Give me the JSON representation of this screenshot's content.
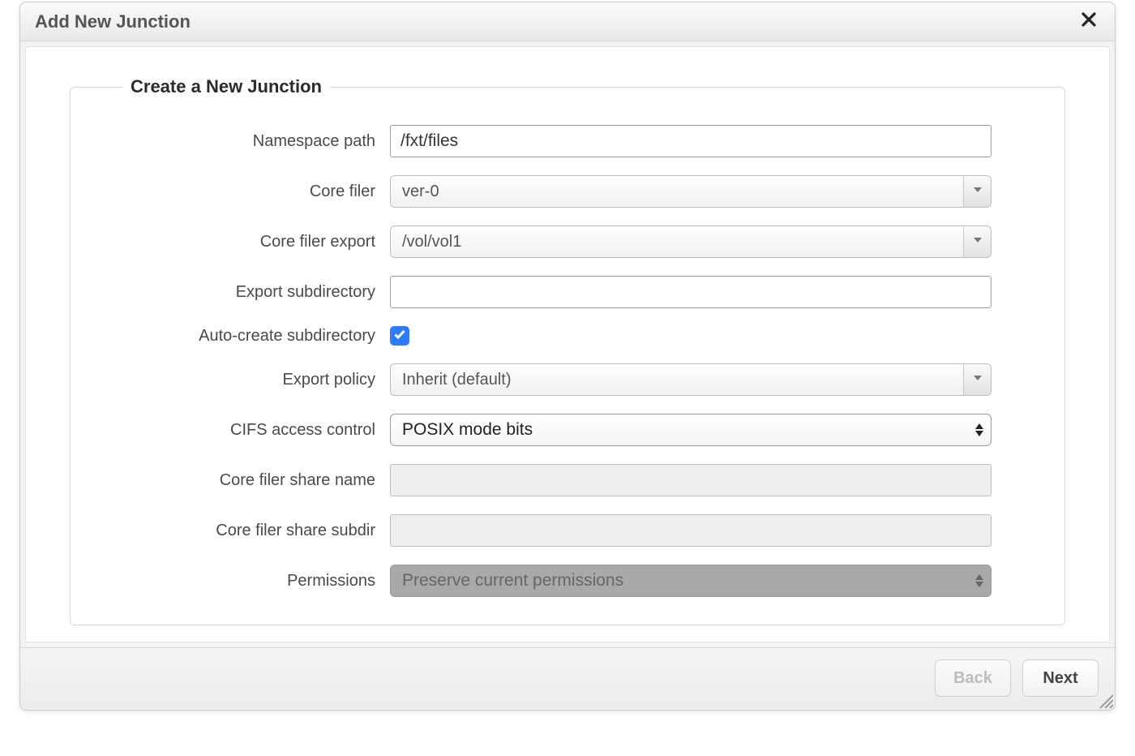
{
  "dialog": {
    "title": "Add New Junction"
  },
  "group": {
    "legend": "Create a New Junction"
  },
  "labels": {
    "namespace_path": "Namespace path",
    "core_filer": "Core filer",
    "core_filer_export": "Core filer export",
    "export_subdirectory": "Export subdirectory",
    "auto_create_subdir": "Auto-create subdirectory",
    "export_policy": "Export policy",
    "cifs_access_control": "CIFS access control",
    "core_filer_share_name": "Core filer share name",
    "core_filer_share_subdir": "Core filer share subdir",
    "permissions": "Permissions"
  },
  "values": {
    "namespace_path": "/fxt/files",
    "core_filer": "ver-0",
    "core_filer_export": "/vol/vol1",
    "export_subdirectory": "",
    "auto_create_subdir": true,
    "export_policy": "Inherit (default)",
    "cifs_access_control": "POSIX mode bits",
    "core_filer_share_name": "",
    "core_filer_share_subdir": "",
    "permissions": "Preserve current permissions"
  },
  "footer": {
    "back": "Back",
    "next": "Next"
  }
}
